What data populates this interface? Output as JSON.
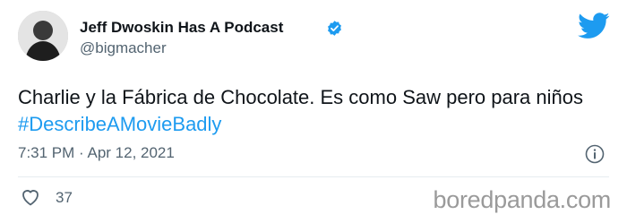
{
  "author": {
    "display_name": "Jeff Dwoskin Has A Podcast",
    "handle": "@bigmacher",
    "verified": true,
    "avatar_icon": "profile-photo"
  },
  "tweet": {
    "text": "Charlie y la Fábrica de Chocolate. Es como Saw pero para niños ",
    "hashtag": "#DescribeAMovieBadly",
    "timestamp": "7:31 PM · Apr 12, 2021"
  },
  "actions": {
    "likes": "37",
    "like_icon": "heart-icon",
    "info_icon": "info-icon"
  },
  "brand": {
    "logo": "twitter-bird-icon",
    "accent": "#1d9bf0",
    "watermark": "boredpanda.com"
  }
}
